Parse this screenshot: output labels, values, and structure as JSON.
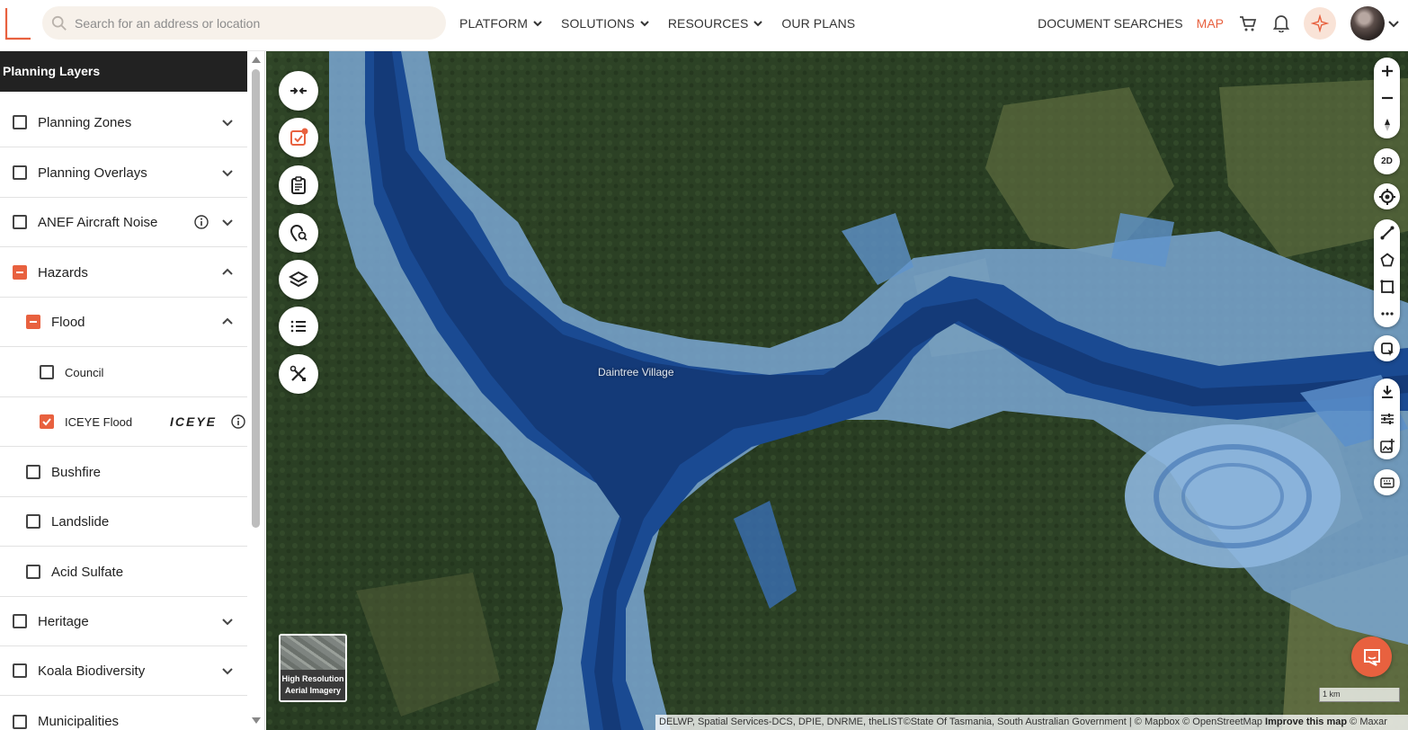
{
  "header": {
    "search_placeholder": "Search for an address or location",
    "nav": [
      {
        "label": "PLATFORM"
      },
      {
        "label": "SOLUTIONS"
      },
      {
        "label": "RESOURCES"
      },
      {
        "label": "OUR PLANS"
      }
    ],
    "document_searches": "DOCUMENT SEARCHES",
    "map": "MAP",
    "icons": [
      "cart-icon",
      "bell-icon",
      "sparkle-icon"
    ]
  },
  "sidebar": {
    "title": "Planning Layers",
    "layers": [
      {
        "label": "Planning Zones",
        "state": "unchecked",
        "expand": "collapsed"
      },
      {
        "label": "Planning Overlays",
        "state": "unchecked",
        "expand": "collapsed"
      },
      {
        "label": "ANEF Aircraft Noise",
        "state": "unchecked",
        "expand": "collapsed",
        "info": true
      },
      {
        "label": "Hazards",
        "state": "partial",
        "expand": "expanded"
      },
      {
        "label": "Flood",
        "state": "partial",
        "expand": "expanded"
      },
      {
        "label": "Council",
        "state": "unchecked"
      },
      {
        "label": "ICEYE Flood",
        "state": "checked",
        "logo": "ICEYE",
        "info": true
      },
      {
        "label": "Bushfire",
        "state": "unchecked"
      },
      {
        "label": "Landslide",
        "state": "unchecked"
      },
      {
        "label": "Acid Sulfate",
        "state": "unchecked"
      },
      {
        "label": "Heritage",
        "state": "unchecked",
        "expand": "collapsed"
      },
      {
        "label": "Koala Biodiversity",
        "state": "unchecked",
        "expand": "collapsed"
      },
      {
        "label": "Municipalities",
        "state": "unchecked"
      }
    ]
  },
  "map": {
    "place_label": "Daintree Village",
    "imagery_label": "High Resolution Aerial Imagery",
    "view_toggle": "2D",
    "scale_label": "1 km",
    "attribution": "DELWP, Spatial Services-DCS, DPIE, DNRME, theLIST©State Of Tasmania, South Australian Government | © Mapbox © OpenStreetMap",
    "improve_link": "Improve this map",
    "attribution_tail": "© Maxar",
    "colors": {
      "accent": "#e8613f",
      "flood_deep": "#17408a",
      "flood_shallow": "#a8c8e8",
      "forest": "#2e4226"
    }
  }
}
